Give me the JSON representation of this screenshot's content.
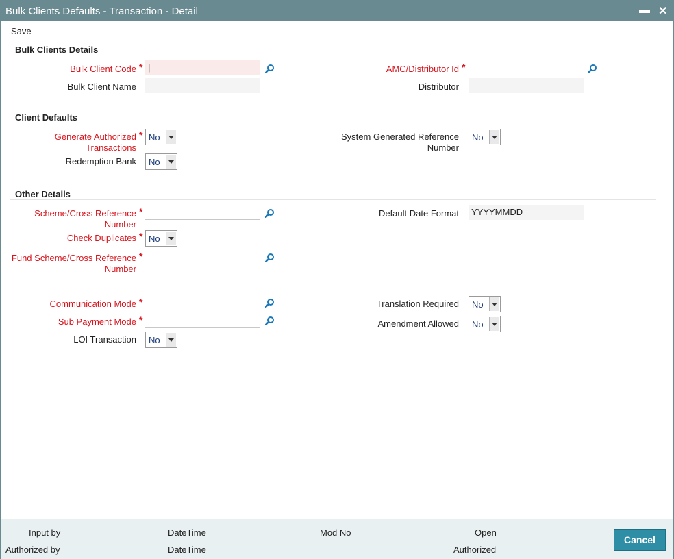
{
  "window": {
    "title": "Bulk Clients Defaults - Transaction - Detail",
    "minimize_glyph": "▬",
    "close_glyph": "✕"
  },
  "menu": {
    "save_label": "Save"
  },
  "sections": {
    "bulk_clients_details": "Bulk Clients Details",
    "client_defaults": "Client Defaults",
    "other_details": "Other Details"
  },
  "bulk": {
    "client_code_label": "Bulk Client Code",
    "client_code_value": "|",
    "client_name_label": "Bulk Client Name",
    "amc_label": "AMC/Distributor Id",
    "distributor_label": "Distributor"
  },
  "defaults": {
    "gen_auth_label_1": "Generate Authorized",
    "gen_auth_label_2": "Transactions",
    "gen_auth_value": "No",
    "redemption_bank_label": "Redemption Bank",
    "redemption_bank_value": "No",
    "sys_ref_label_1": "System Generated Reference",
    "sys_ref_label_2": "Number",
    "sys_ref_value": "No"
  },
  "other": {
    "scheme_label_1": "Scheme/Cross Reference",
    "scheme_label_2": "Number",
    "check_dup_label": "Check Duplicates",
    "check_dup_value": "No",
    "fund_scheme_label_1": "Fund Scheme/Cross Reference",
    "fund_scheme_label_2": "Number",
    "date_format_label": "Default Date Format",
    "date_format_value": "YYYYMMDD",
    "comm_mode_label": "Communication Mode",
    "sub_payment_label": "Sub Payment Mode",
    "loi_label": "LOI Transaction",
    "loi_value": "No",
    "translation_label": "Translation Required",
    "translation_value": "No",
    "amendment_label": "Amendment Allowed",
    "amendment_value": "No"
  },
  "footer": {
    "input_by": "Input by",
    "authorized_by": "Authorized by",
    "datetime_1": "DateTime",
    "datetime_2": "DateTime",
    "mod_no": "Mod No",
    "open": "Open",
    "authorized": "Authorized",
    "cancel_label": "Cancel"
  },
  "colors": {
    "titlebar": "#6a8a92",
    "required_label": "#d8141c",
    "footer_bg": "#e8f0f2",
    "cancel_button": "#2e8ea6",
    "lov_icon": "#1b78b8"
  },
  "icons": {
    "lov": "search-icon"
  }
}
